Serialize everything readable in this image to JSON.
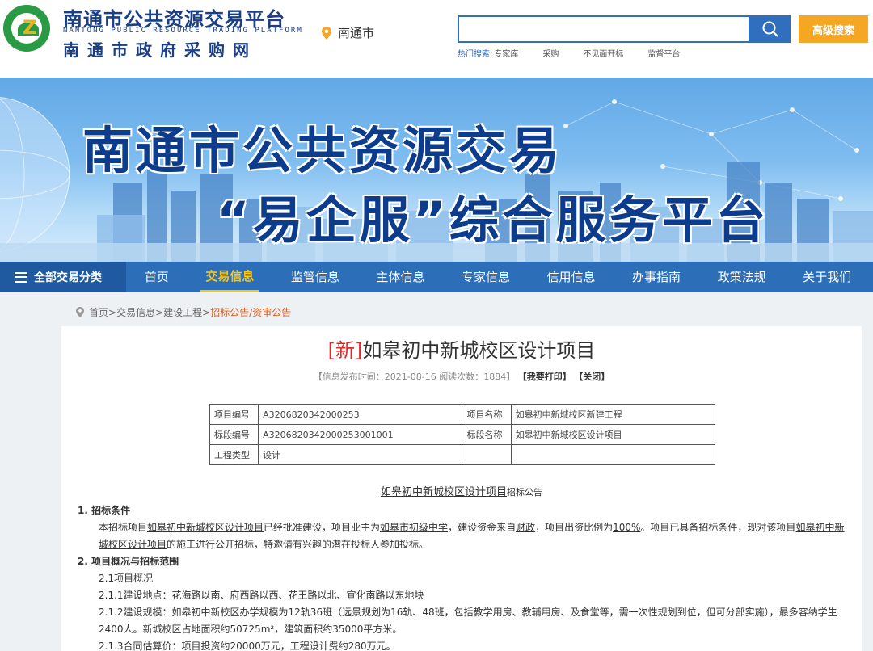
{
  "brand": {
    "title": "南通市公共资源交易平台",
    "english": "NANTONG PUBLIC RESOURCE TRADING PLATFORM",
    "subtitle": "南通市政府采购网"
  },
  "location": {
    "city": "南通市",
    "icon": "map-pin-icon"
  },
  "search": {
    "placeholder": "",
    "button_icon": "search-icon",
    "advanced_label": "高级搜索",
    "hot_label": "热门搜索:",
    "hot_words": [
      "专家库",
      "采购",
      "不见面开标",
      "监督平台"
    ]
  },
  "banner": {
    "line1": "南通市公共资源交易",
    "line2": "“易企服”综合服务平台"
  },
  "nav": {
    "all_label": "全部交易分类",
    "items": [
      "首页",
      "交易信息",
      "监管信息",
      "主体信息",
      "专家信息",
      "信用信息",
      "办事指南",
      "政策法规",
      "关于我们"
    ],
    "active_index": 1
  },
  "breadcrumb": {
    "items": [
      "首页",
      "交易信息",
      "建设工程"
    ],
    "sep": " > ",
    "current": "招标公告/资审公告"
  },
  "article": {
    "new_tag": "[新]",
    "title": "如皋初中新城校区设计项目",
    "meta_info": "【信息发布时间：2021-08-16 阅读次数：1884】",
    "print_label": "【我要打印】",
    "close_label": "【关闭】",
    "table": [
      [
        "项目编号",
        "A3206820342000253",
        "项目名称",
        "如皋初中新城校区新建工程"
      ],
      [
        "标段编号",
        "A3206820342000253001001",
        "标段名称",
        "如皋初中新城校区设计项目"
      ],
      [
        "工程类型",
        "设计",
        "",
        ""
      ]
    ],
    "notice_title_link": "如皋初中新城校区设计项目",
    "notice_title_suffix": "招标公告",
    "section1_heading": "1. 招标条件",
    "section1": {
      "t1": "本招标项目",
      "project": "如皋初中新城校区设计项目",
      "t2": "已经批准建设，项目业主为",
      "owner": "如皋市初级中学",
      "t3": "，建设资金来自",
      "fund": "财政",
      "t4": "，项目出资比例为",
      "ratio": "100%",
      "t5": "。项目已具备招标条件，现对该项目",
      "project2": "如皋初中新城校区设计项目",
      "t6": "的施工进行公开招标，特邀请有兴趣的潜在投标人参加投标。"
    },
    "section2_heading": "2. 项目概况与招标范围",
    "s21": "2.1项目概况",
    "s211": "2.1.1建设地点：花海路以南、府西路以西、花王路以北、宣化南路以东地块",
    "s212": "2.1.2建设规模：如皋初中新校区办学规模为12轨36班（远景规划为16轨、48班，包括教学用房、教辅用房、及食堂等，需一次性规划到位，但可分部实施），最多容纳学生2400人。新城校区占地面积约50725m²，建筑面积约35000平方米。",
    "s213": "2.1.3合同估算价：项目投资约20000万元，工程设计费约280万元。"
  },
  "colors": {
    "brand_blue": "#1a3f87",
    "nav_blue": "#2d6eb8",
    "accent_orange": "#f5a623",
    "active_yellow": "#f5c518",
    "new_red": "#d92b2b"
  }
}
